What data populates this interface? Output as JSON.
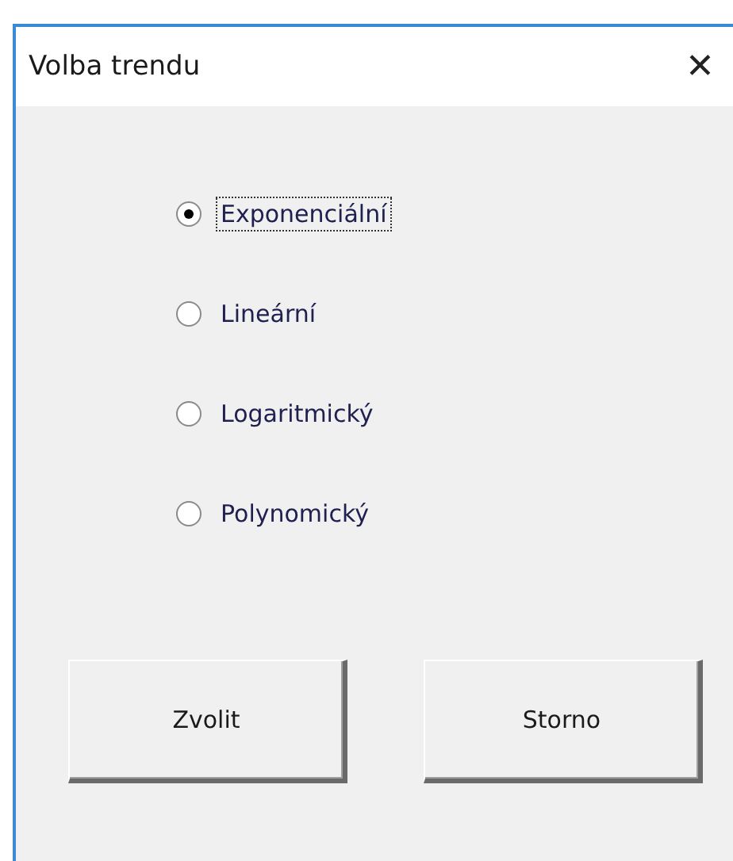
{
  "window": {
    "title": "Volba trendu",
    "close": "✕"
  },
  "options": [
    {
      "label": "Exponenciální",
      "selected": true,
      "focused": true
    },
    {
      "label": "Lineární",
      "selected": false,
      "focused": false
    },
    {
      "label": "Logaritmický",
      "selected": false,
      "focused": false
    },
    {
      "label": "Polynomický",
      "selected": false,
      "focused": false
    }
  ],
  "buttons": [
    "Zvolit",
    "Storno"
  ]
}
